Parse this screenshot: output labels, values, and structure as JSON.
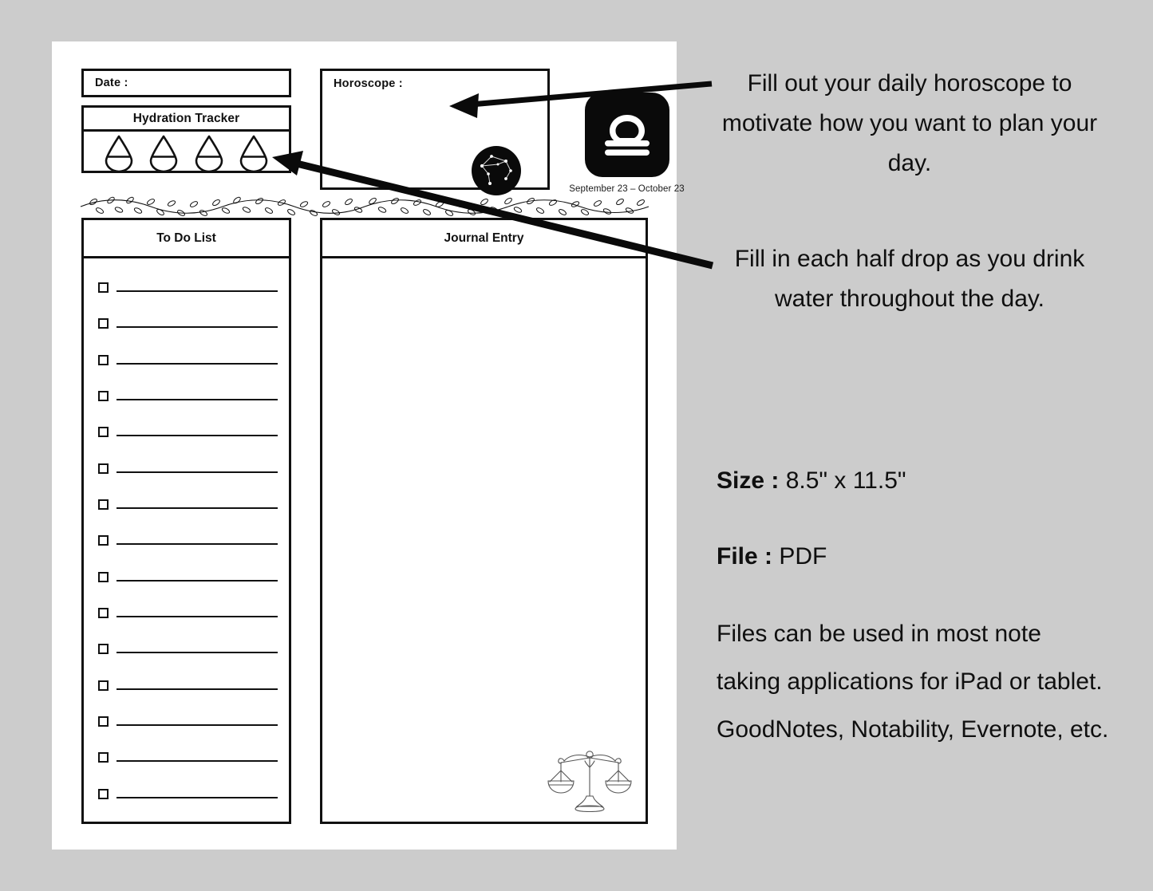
{
  "theme": {
    "background": "#cccccc",
    "paper": "#ffffff",
    "ink": "#111111",
    "badge": "#0a0a0a"
  },
  "planner": {
    "date_field": {
      "label": "Date :"
    },
    "hydration": {
      "title": "Hydration Tracker",
      "drop_count": 4,
      "drop_icon": "water-drop-icon"
    },
    "horoscope": {
      "label": "Horoscope :",
      "constellation_icon": "libra-constellation-icon"
    },
    "zodiac": {
      "sign": "Libra",
      "glyph_icon": "libra-glyph-icon",
      "date_range": "September 23 – October 23"
    },
    "divider": {
      "icon": "leafy-vine-divider-icon"
    },
    "todo": {
      "title": "To Do List",
      "row_count": 15,
      "checkbox_icon": "checkbox-icon"
    },
    "journal": {
      "title": "Journal Entry",
      "illustration_icon": "balance-scales-icon"
    }
  },
  "annotations": {
    "horoscope_note": "Fill out your daily horoscope to motivate how you want to plan your day.",
    "hydration_note": "Fill in each half drop as you drink water throughout the day.",
    "arrows": [
      {
        "name": "arrow-to-horoscope"
      },
      {
        "name": "arrow-to-hydration"
      }
    ]
  },
  "specs": {
    "size_key": "Size :",
    "size_value": "8.5\" x 11.5\"",
    "file_key": "File :",
    "file_value": "PDF",
    "compatibility_note": "Files can be used in most note taking applications for iPad or tablet. GoodNotes, Notability, Evernote, etc."
  }
}
